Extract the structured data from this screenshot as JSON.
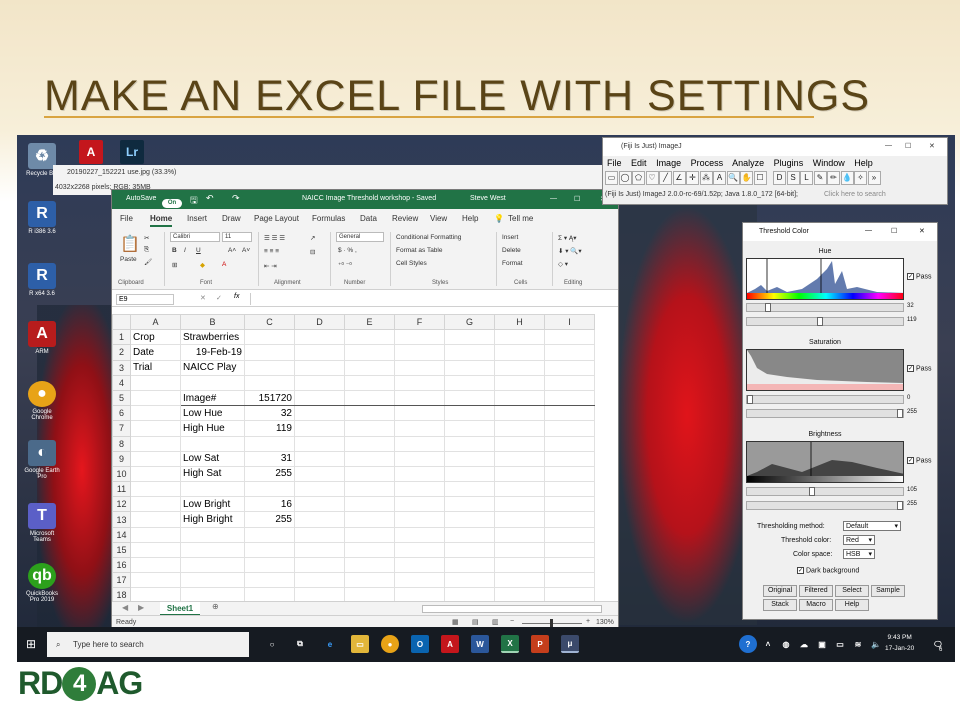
{
  "slide": {
    "title": "MAKE AN EXCEL FILE WITH SETTINGS",
    "logo_left": "RD",
    "logo_mid": "4",
    "logo_right": "AG"
  },
  "image_window": {
    "title": "20190227_152221 use.jpg (33.3%)",
    "info": "4032x2268 pixels; RGB; 35MB"
  },
  "desktop_icons": [
    {
      "label": "Recycle Bin",
      "icon": "recycle-bin-icon"
    },
    {
      "label": "R i386 3.6",
      "icon": "r-icon"
    },
    {
      "label": "R x64 3.6",
      "icon": "r-icon"
    },
    {
      "label": "ARM",
      "icon": "arm-icon"
    },
    {
      "label": "Google Chrome",
      "icon": "chrome-icon"
    },
    {
      "label": "Google Earth Pro",
      "icon": "earth-icon"
    },
    {
      "label": "Microsoft Teams",
      "icon": "teams-icon"
    },
    {
      "label": "QuickBooks Pro 2019",
      "icon": "quickbooks-icon"
    }
  ],
  "excel": {
    "autosave": "AutoSave",
    "autosave_state": "On",
    "title": "NAICC Image Threshold workshop  -  Saved",
    "user": "Steve West",
    "tabs": [
      "File",
      "Home",
      "Insert",
      "Draw",
      "Page Layout",
      "Formulas",
      "Data",
      "Review",
      "View",
      "Help"
    ],
    "tell_me": "Tell me",
    "ribbon": {
      "paste": "Paste",
      "clipboard": "Clipboard",
      "font_name": "Calibri",
      "font_size": "11",
      "font": "Font",
      "alignment": "Alignment",
      "number_format": "General",
      "number": "Number",
      "conditional": "Conditional Formatting",
      "format_table": "Format as Table",
      "cell_styles": "Cell Styles",
      "styles": "Styles",
      "insert": "Insert",
      "delete": "Delete",
      "format": "Format",
      "cells": "Cells",
      "editing": "Editing"
    },
    "name_box": "E9",
    "columns": [
      "A",
      "B",
      "C",
      "D",
      "E",
      "F",
      "G",
      "H",
      "I"
    ],
    "rows": [
      {
        "n": "1",
        "a": "Crop",
        "b": "Strawberries",
        "c": ""
      },
      {
        "n": "2",
        "a": "Date",
        "b": "19-Feb-19",
        "c": ""
      },
      {
        "n": "3",
        "a": "Trial",
        "b": "NAICC Play",
        "c": ""
      },
      {
        "n": "4",
        "a": "",
        "b": "",
        "c": ""
      },
      {
        "n": "5",
        "a": "",
        "b": "Image#",
        "c": "151720"
      },
      {
        "n": "6",
        "a": "",
        "b": "Low Hue",
        "c": "32"
      },
      {
        "n": "7",
        "a": "",
        "b": "High Hue",
        "c": "119"
      },
      {
        "n": "8",
        "a": "",
        "b": "",
        "c": ""
      },
      {
        "n": "9",
        "a": "",
        "b": "Low Sat",
        "c": "31"
      },
      {
        "n": "10",
        "a": "",
        "b": "High Sat",
        "c": "255"
      },
      {
        "n": "11",
        "a": "",
        "b": "",
        "c": ""
      },
      {
        "n": "12",
        "a": "",
        "b": "Low Bright",
        "c": "16"
      },
      {
        "n": "13",
        "a": "",
        "b": "High Bright",
        "c": "255"
      },
      {
        "n": "14",
        "a": "",
        "b": "",
        "c": ""
      },
      {
        "n": "15",
        "a": "",
        "b": "",
        "c": ""
      },
      {
        "n": "16",
        "a": "",
        "b": "",
        "c": ""
      },
      {
        "n": "17",
        "a": "",
        "b": "",
        "c": ""
      },
      {
        "n": "18",
        "a": "",
        "b": "",
        "c": ""
      }
    ],
    "sheet_tab": "Sheet1",
    "status": "Ready",
    "zoom": "130%"
  },
  "imagej": {
    "title": "(Fiji Is Just) ImageJ",
    "menus": [
      "File",
      "Edit",
      "Image",
      "Process",
      "Analyze",
      "Plugins",
      "Window",
      "Help"
    ],
    "status": "(Fiji Is Just) ImageJ 2.0.0-rc-69/1.52p; Java 1.8.0_172 [64-bit];",
    "search_hint": "Click here to search"
  },
  "threshold": {
    "title": "Threshold Color",
    "hue_label": "Hue",
    "sat_label": "Saturation",
    "bright_label": "Brightness",
    "pass": "Pass",
    "hue_low": "32",
    "hue_high": "119",
    "sat_low": "0",
    "sat_high": "255",
    "bright_low": "105",
    "bright_high": "255",
    "method_label": "Thresholding method:",
    "method_value": "Default",
    "color_label": "Threshold color:",
    "color_value": "Red",
    "space_label": "Color space:",
    "space_value": "HSB",
    "dark_bg": "Dark background",
    "buttons_row1": [
      "Original",
      "Filtered",
      "Select",
      "Sample"
    ],
    "buttons_row2": [
      "Stack",
      "Macro",
      "Help"
    ]
  },
  "taskbar": {
    "search_placeholder": "Type here to search",
    "time": "9:43 PM",
    "date": "17-Jan-20",
    "notif_count": "6"
  },
  "colors": {
    "excel_green": "#217346",
    "title_brown": "#5a4417",
    "accent_gold": "#d9a441"
  }
}
